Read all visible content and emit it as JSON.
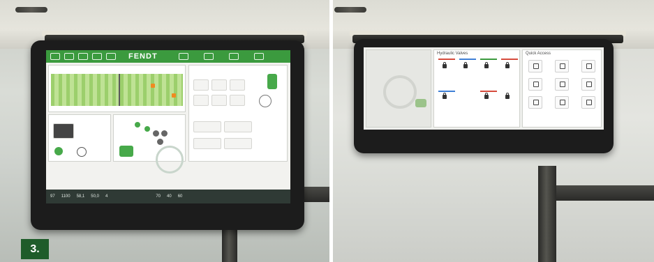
{
  "left_photo": {
    "label": "3.",
    "screen": {
      "brand": "FENDT",
      "status": [
        "97",
        "1100",
        "58,1",
        "50,0",
        "4",
        "70",
        "40",
        "60"
      ]
    }
  },
  "right_photo": {
    "screen": {
      "panels": [
        "Hydraulic Valves",
        "Quick Access"
      ]
    }
  },
  "colors": {
    "fendt_green": "#3b9a3e",
    "badge_green": "#1f5c2a",
    "accent_orange": "#f08a20"
  }
}
